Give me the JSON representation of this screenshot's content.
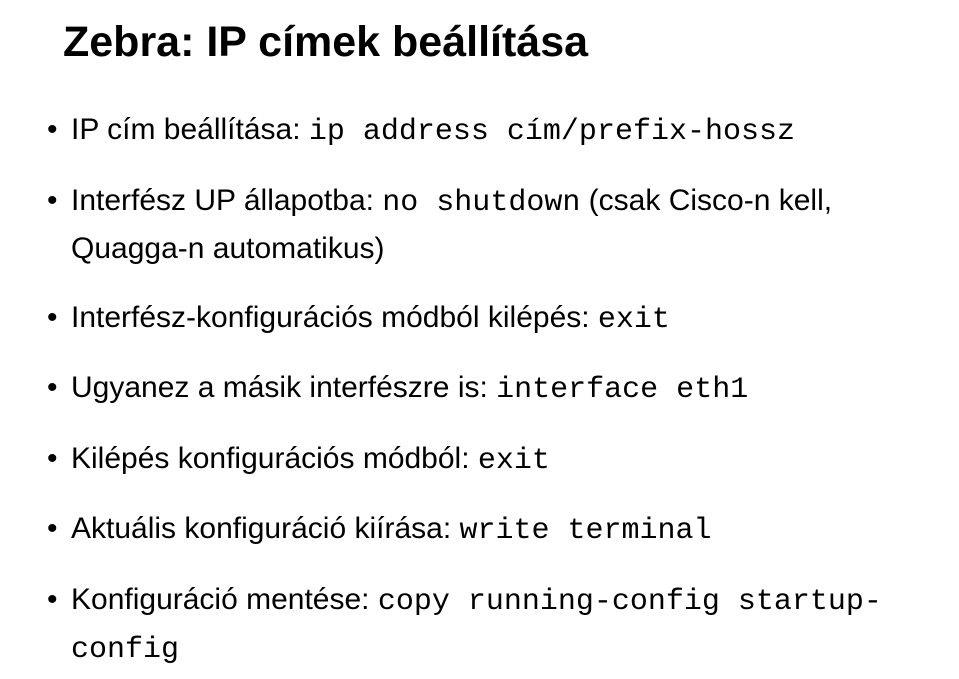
{
  "title": "Zebra: IP címek beállítása",
  "items": [
    {
      "pre": "IP cím beállítása: ",
      "code": "ip address cím/prefix-hossz",
      "post": ""
    },
    {
      "pre": "Interfész UP állapotba: ",
      "code": "no shutdown",
      "post": " (csak Cisco-n kell, Quagga-n automatikus)"
    },
    {
      "pre": "Interfész-konfigurációs módból kilépés: ",
      "code": "exit",
      "post": ""
    },
    {
      "pre": "Ugyanez a másik interfészre is: ",
      "code": "interface eth1",
      "post": ""
    },
    {
      "pre": "Kilépés konfigurációs módból: ",
      "code": "exit",
      "post": ""
    },
    {
      "pre": "Aktuális konfiguráció kiírása: ",
      "code": "write terminal",
      "post": ""
    },
    {
      "pre": "Konfiguráció mentése: ",
      "code": "copy running-config startup-config",
      "post": ""
    }
  ]
}
